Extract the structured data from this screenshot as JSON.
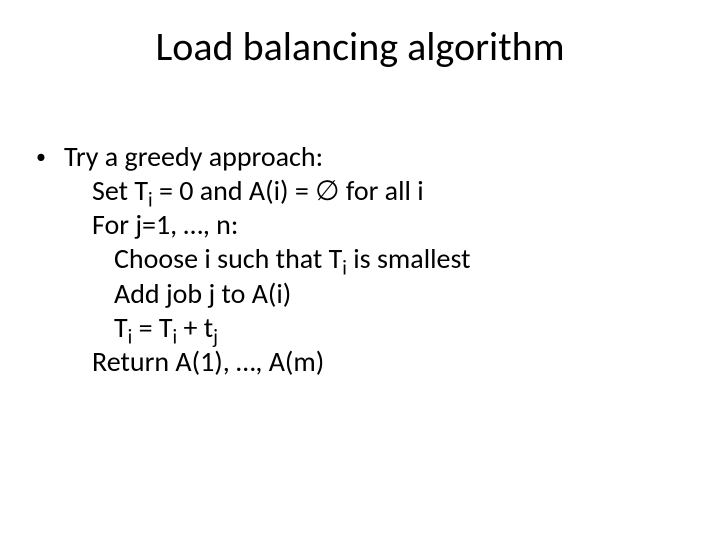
{
  "title": "Load balancing algorithm",
  "bullet": {
    "lead": "Try a greedy approach:",
    "line_set": {
      "pre": "Set T",
      "sub_i_1": "i",
      "mid": " = 0 and A(i) = ∅ for all i"
    },
    "line_for": "For j=1, …, n:",
    "line_choose": {
      "pre": "Choose i such that T",
      "sub_i": "i",
      "post": " is smallest"
    },
    "line_add": "Add job j to A(i)",
    "line_update": {
      "t1_pre": "T",
      "t1_sub": "i",
      "eq": " = T",
      "t2_sub": "i",
      "plus": " + t",
      "tj_sub": "j"
    },
    "line_return": "Return A(1), …, A(m)"
  }
}
